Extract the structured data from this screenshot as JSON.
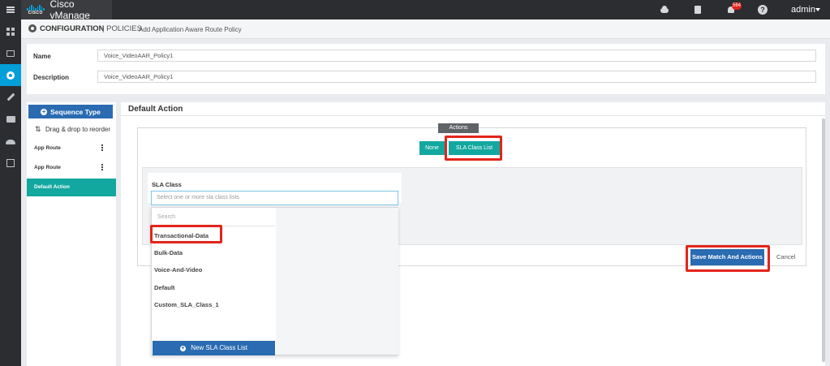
{
  "header": {
    "app_title": "Cisco vManage",
    "logo_text": "CISCO",
    "notification_count": "564",
    "help_glyph": "?",
    "user": "admin"
  },
  "icons": {
    "left_nav": [
      "dashboard-icon",
      "monitor-icon",
      "configuration-gear-icon",
      "tools-wrench-icon",
      "maintenance-briefcase-icon",
      "administration-users-icon",
      "analytics-icon"
    ],
    "top_bar": [
      "cloud-icon",
      "tasks-clipboard-icon",
      "bell-icon",
      "help-icon"
    ]
  },
  "colors": {
    "topbar": "#2b2d30",
    "accent_blue": "#2a6bb1",
    "teal": "#12a8a0",
    "nav_active": "#049fd9",
    "highlight_red": "#e3241b"
  },
  "breadcrumb": {
    "section": "CONFIGURATION",
    "subsection": "| POLICIES",
    "page": "Add Application Aware Route Policy"
  },
  "form": {
    "name_label": "Name",
    "name_value": "Voice_VideoAAR_Policy1",
    "description_label": "Description",
    "description_value": "Voice_VideoAAR_Policy1"
  },
  "sequence_panel": {
    "sequence_type_label": "Sequence Type",
    "reorder_hint": "Drag & drop to reorder",
    "items": [
      {
        "label": "App Route"
      },
      {
        "label": "App Route"
      },
      {
        "label": "Default Action"
      }
    ]
  },
  "main": {
    "title": "Default Action",
    "actions_tab": "Actions",
    "none_button": "None",
    "sla_class_list_button": "SLA Class List",
    "sla_class_label": "SLA Class",
    "sla_select_placeholder": "Select one or more sla class lists",
    "save_button": "Save Match And Actions",
    "cancel_button": "Cancel"
  },
  "dropdown": {
    "search_placeholder": "Search",
    "options": [
      "Transactional-Data",
      "Bulk-Data",
      "Voice-And-Video",
      "Default",
      "Custom_SLA_Class_1"
    ],
    "new_button": "New SLA Class List"
  }
}
